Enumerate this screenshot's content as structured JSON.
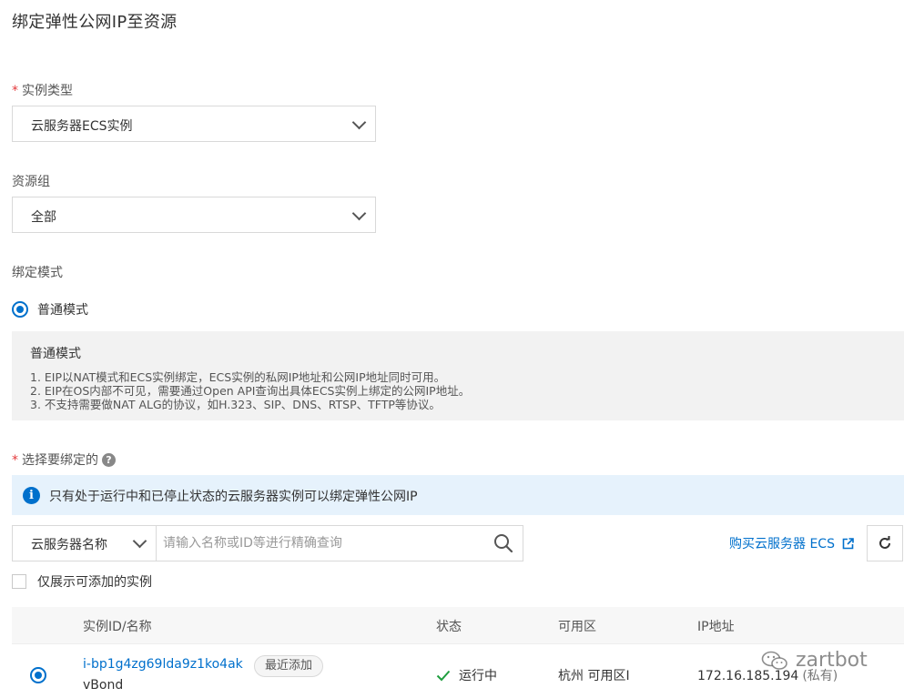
{
  "page": {
    "title": "绑定弹性公网IP至资源"
  },
  "instance_type": {
    "required_mark": "*",
    "label": "实例类型",
    "selected": "云服务器ECS实例"
  },
  "resource_group": {
    "label": "资源组",
    "selected": "全部"
  },
  "bind_mode": {
    "label": "绑定模式",
    "option_label": "普通模式",
    "selected": true,
    "description": {
      "title": "普通模式",
      "lines": [
        "1. EIP以NAT模式和ECS实例绑定，ECS实例的私网IP地址和公网IP地址同时可用。",
        "2. EIP在OS内部不可见，需要通过Open API查询出具体ECS实例上绑定的公网IP地址。",
        "3. 不支持需要做NAT ALG的协议，如H.323、SIP、DNS、RTSP、TFTP等协议。"
      ]
    }
  },
  "select_bind": {
    "required_mark": "*",
    "label": "选择要绑定的",
    "help_icon": "question-circle-icon",
    "help_glyph": "?",
    "info_icon": "info-circle-icon",
    "info_glyph": "i",
    "info_text": "只有处于运行中和已停止状态的云服务器实例可以绑定弹性公网IP"
  },
  "search": {
    "type_selected": "云服务器名称",
    "placeholder": "请输入名称或ID等进行精确查询",
    "search_icon": "search-icon"
  },
  "buy_link": {
    "label": "购买云服务器 ECS",
    "icon": "external-link-icon"
  },
  "refresh": {
    "icon": "refresh-icon"
  },
  "filter_checkbox": {
    "label": "仅展示可添加的实例",
    "checked": false
  },
  "table": {
    "headers": {
      "instance": "实例ID/名称",
      "status": "状态",
      "zone": "可用区",
      "ip": "IP地址"
    },
    "rows": [
      {
        "selected": true,
        "instance_id": "i-bp1g4zg69lda9z1ko4ak",
        "name": "vBond",
        "tag": "最近添加",
        "status": "运行中",
        "status_icon": "check-icon",
        "zone": "杭州 可用区I",
        "ip": "172.16.185.194",
        "ip_type": "(私有)"
      }
    ]
  },
  "watermark": {
    "text": "zartbot",
    "icon": "wechat-icon"
  },
  "colors": {
    "accent": "#0070cc",
    "required": "#e4393c",
    "success": "#1e9e3e",
    "info_bg": "#e6f2fc",
    "panel_bg": "#f2f2f2"
  }
}
